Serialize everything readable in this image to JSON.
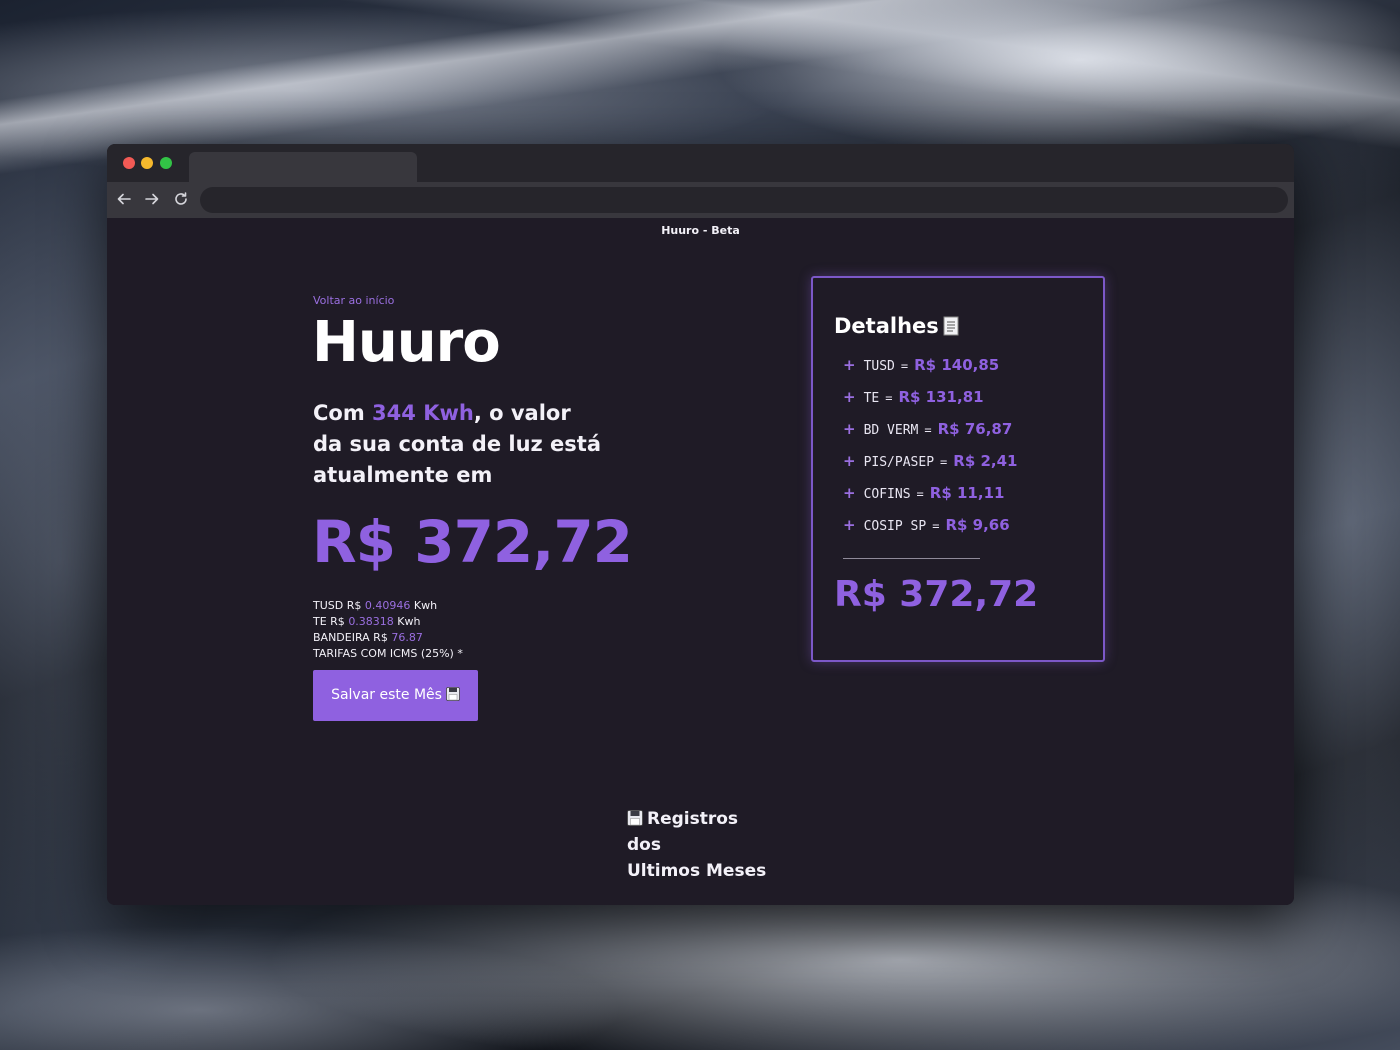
{
  "browser": {
    "tab_title": "",
    "address": ""
  },
  "page": {
    "title": "Huuro - Beta",
    "back_link": "Voltar ao início",
    "brand": "Huuro",
    "intro_prefix": "Com ",
    "intro_kwh": "344 Kwh",
    "intro_suffix": ", o valor da sua conta de luz está atualmente em",
    "total": "R$ 372,72",
    "rates": [
      {
        "label": "TUSD R$ ",
        "value": "0.40946",
        "unit": " Kwh"
      },
      {
        "label": "TE R$ ",
        "value": "0.38318",
        "unit": " Kwh"
      },
      {
        "label": "BANDEIRA R$ ",
        "value": "76.87",
        "unit": ""
      }
    ],
    "tax_note": "TARIFAS COM ICMS (25%) *",
    "save_button": "Salvar este Mês",
    "records_title_line1": "Registros dos",
    "records_title_line2": "Ultimos Meses"
  },
  "details": {
    "title": "Detalhes",
    "items": [
      {
        "code": "TUSD",
        "amount": "R$ 140,85"
      },
      {
        "code": "TE",
        "amount": "R$ 131,81"
      },
      {
        "code": "BD VERM",
        "amount": "R$ 76,87"
      },
      {
        "code": "PIS/PASEP",
        "amount": "R$ 2,41"
      },
      {
        "code": "COFINS",
        "amount": "R$ 11,11"
      },
      {
        "code": "COSIP SP",
        "amount": "R$ 9,66"
      }
    ],
    "plus_symbol": "+",
    "equals_symbol": "=",
    "total": "R$ 372,72"
  },
  "icons": {
    "back": "arrow-left-icon",
    "forward": "arrow-right-icon",
    "reload": "reload-icon",
    "details": "document-icon",
    "save": "floppy-disk-icon"
  },
  "colors": {
    "accent": "#8f61e0",
    "page_bg": "#1f1b26",
    "text": "#ffffff"
  }
}
